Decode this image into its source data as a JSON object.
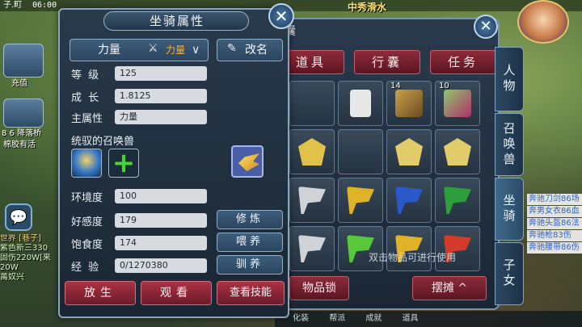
{
  "hud": {
    "clock": "06:00",
    "signal": "子.町",
    "top_name": "中秀滑水",
    "charge_label": "充值",
    "tile1_label": "8 6 降落桥",
    "tile2_label": "棉胶有活"
  },
  "chat": {
    "lines": [
      "世界 [巷子]",
      "紫色新三330",
      "固伤220W[来",
      "20W",
      "萬奴兴"
    ]
  },
  "bag": {
    "title": "囊",
    "tabs": [
      "道具",
      "行囊",
      "任务"
    ],
    "counts": [
      "14",
      "10"
    ],
    "hint": "双击物品可进行使用",
    "lock_label": "物品锁",
    "stall_label": "摆摊 ^"
  },
  "side_tabs": [
    "人物",
    "召唤兽",
    "坐骑",
    "子女"
  ],
  "right_info": [
    "奔驰刀剑86场",
    "奔男女衣86血",
    "奔驰头盔86法",
    "奔驰枪83伤",
    "奔驰腰带86伤"
  ],
  "bottom_bar": [
    "化装",
    "帮派",
    "成就",
    "道具"
  ],
  "mount": {
    "title": "坐骑属性",
    "attr_select_label": "力量",
    "attr_select_value": "力量",
    "rename_label": "改名",
    "level_label": "等  级",
    "level": "125",
    "growth_label": "成  长",
    "growth": "1.8125",
    "main_attr_label": "主属性",
    "main_attr": "力量",
    "controlled_label": "统驭的召唤兽",
    "env_label": "环境度",
    "env": "100",
    "favor_label": "好感度",
    "favor": "179",
    "satiety_label": "饱食度",
    "satiety": "174",
    "exp_label": "经  验",
    "exp": "0/1270380",
    "train_label": "修炼",
    "feed_label": "喂养",
    "tame_label": "驯养",
    "release_label": "放生",
    "view_label": "观看",
    "skills_label": "查看技能"
  },
  "colors": {
    "accent_red": "#a93243",
    "panel_blue": "#293a4b",
    "value_orange": "#ffb13b"
  }
}
